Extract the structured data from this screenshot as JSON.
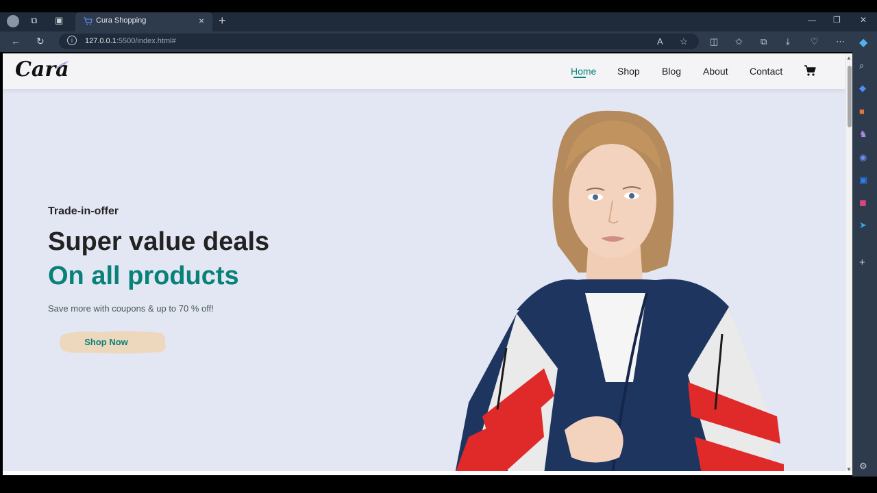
{
  "browser": {
    "tab_title": "Cura Shopping",
    "tab_close": "×",
    "new_tab": "+",
    "url_host": "127.0.0.1",
    "url_path": ":5500/index.html#",
    "window_controls": {
      "minimize": "—",
      "restore": "❐",
      "close": "✕"
    },
    "toolbar_icons": [
      "read-aloud-icon",
      "favorite-star-icon",
      "split-screen-icon",
      "favorites-icon",
      "collections-icon",
      "downloads-icon",
      "browser-essentials-icon",
      "more-icon"
    ],
    "sidebar_icons": [
      "copilot-icon",
      "search-icon",
      "shopping-tag-icon",
      "tools-icon",
      "games-icon",
      "edge-drop-icon",
      "outlook-icon",
      "office-icon",
      "telegram-icon",
      "add-icon",
      "settings-icon"
    ]
  },
  "site": {
    "logo_text": "Cara",
    "nav": [
      {
        "label": "Home",
        "active": true
      },
      {
        "label": "Shop",
        "active": false
      },
      {
        "label": "Blog",
        "active": false
      },
      {
        "label": "About",
        "active": false
      },
      {
        "label": "Contact",
        "active": false
      }
    ],
    "cart_icon": "cart-icon"
  },
  "hero": {
    "subtitle": "Trade-in-offer",
    "title": "Super value deals",
    "title_highlight": "On all products",
    "description": "Save more with coupons & up to 70 % off!",
    "button_label": "Shop Now",
    "image": "woman-in-track-jacket"
  },
  "colors": {
    "accent": "#088178",
    "hero_bg": "#e3e6f3",
    "button_bg": "#edd8bd",
    "browser_dark": "#1f2b3a",
    "browser_mid": "#2e3b4d"
  }
}
